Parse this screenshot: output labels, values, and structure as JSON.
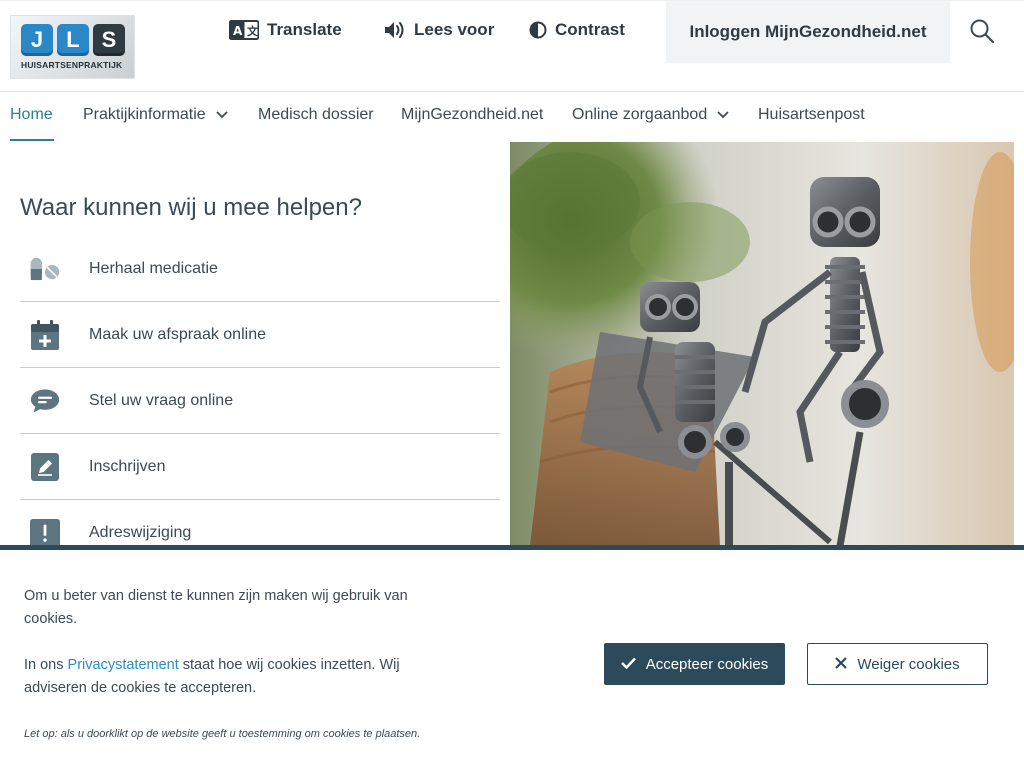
{
  "logo": {
    "letters": [
      "J",
      "L",
      "S"
    ],
    "subtitle": "HUISARTSENPRAKTIJK"
  },
  "toolbar": {
    "translate": "Translate",
    "read_aloud": "Lees voor",
    "contrast": "Contrast",
    "login": "Inloggen MijnGezondheid.net"
  },
  "nav": {
    "items": [
      {
        "label": "Home"
      },
      {
        "label": "Praktijkinformatie"
      },
      {
        "label": "Medisch dossier"
      },
      {
        "label": "MijnGezondheid.net"
      },
      {
        "label": "Online zorgaanbod"
      },
      {
        "label": "Huisartsenpost"
      }
    ]
  },
  "main": {
    "title": "Waar kunnen wij u mee helpen?",
    "actions": [
      {
        "label": "Herhaal medicatie",
        "icon": "pills-icon"
      },
      {
        "label": "Maak uw afspraak online",
        "icon": "calendar-plus-icon"
      },
      {
        "label": "Stel uw vraag online",
        "icon": "chat-bubble-icon"
      },
      {
        "label": "Inschrijven",
        "icon": "pencil-icon"
      },
      {
        "label": "Adreswijziging",
        "icon": "exclamation-icon"
      }
    ]
  },
  "cookie": {
    "text1": "Om u beter van dienst te kunnen zijn maken wij gebruik van cookies.",
    "text2_before": "In ons ",
    "text2_link": "Privacystatement",
    "text2_after": " staat hoe wij cookies inzetten. Wij adviseren de cookies te accepteren.",
    "note": "Let op: als u doorklikt op de website geeft u toestemming om cookies te plaatsen.",
    "accept": "Accepteer cookies",
    "reject": "Weiger cookies"
  },
  "colors": {
    "accent": "#2f7f8f",
    "dark": "#2c4a5a",
    "link": "#2a8fc0",
    "icon": "#5d7580"
  }
}
